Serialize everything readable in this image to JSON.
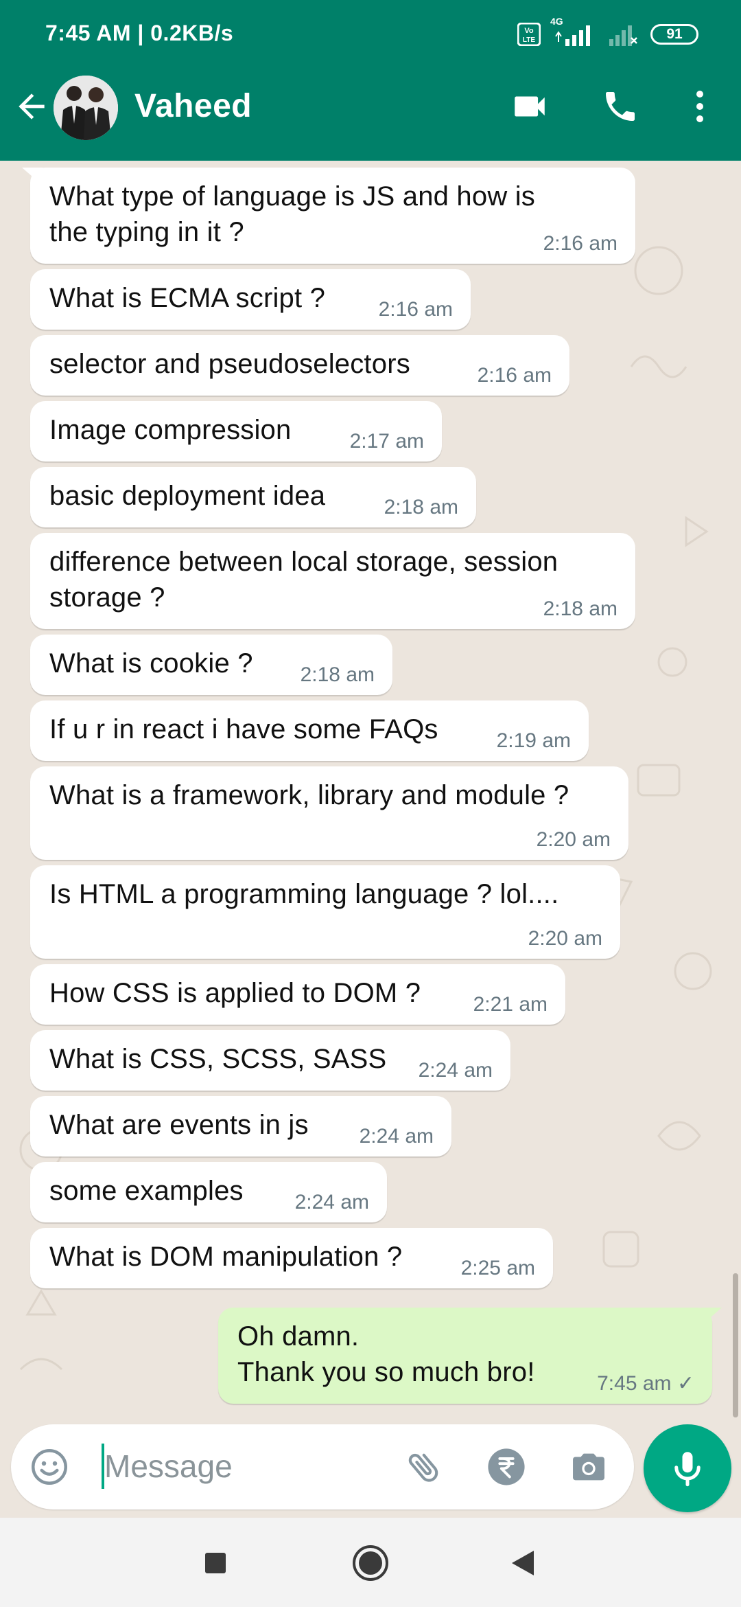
{
  "status_bar": {
    "time": "7:45 AM | 0.2KB/s",
    "network": "4G",
    "volte": "Vo LTE",
    "battery": "91"
  },
  "header": {
    "contact_name": "Vaheed",
    "icons": [
      "back-arrow-icon",
      "avatar",
      "video-call-icon",
      "voice-call-icon",
      "more-options-icon"
    ],
    "color": "#008069"
  },
  "messages": [
    {
      "direction": "in",
      "text": "What type of language is JS and how is\nthe typing in it ?",
      "time": "2:16 am"
    },
    {
      "direction": "in",
      "text": "What is ECMA script ?",
      "time": "2:16 am"
    },
    {
      "direction": "in",
      "text": "selector and pseudoselectors",
      "time": "2:16 am"
    },
    {
      "direction": "in",
      "text": "Image compression",
      "time": "2:17 am"
    },
    {
      "direction": "in",
      "text": "basic deployment idea",
      "time": "2:18 am"
    },
    {
      "direction": "in",
      "text": "difference between local storage, session\nstorage ?",
      "time": "2:18 am"
    },
    {
      "direction": "in",
      "text": "What is cookie ?",
      "time": "2:18 am"
    },
    {
      "direction": "in",
      "text": "If u r in react i have some FAQs",
      "time": "2:19 am"
    },
    {
      "direction": "in",
      "text": "What is a framework, library and module ?",
      "time": "2:20 am"
    },
    {
      "direction": "in",
      "text": "Is HTML a programming language ? lol....",
      "time": "2:20 am"
    },
    {
      "direction": "in",
      "text": "How CSS is applied to DOM ?",
      "time": "2:21 am"
    },
    {
      "direction": "in",
      "text": "What is CSS, SCSS, SASS",
      "time": "2:24 am"
    },
    {
      "direction": "in",
      "text": "What are events in js",
      "time": "2:24 am"
    },
    {
      "direction": "in",
      "text": "some examples",
      "time": "2:24 am"
    },
    {
      "direction": "in",
      "text": "What is DOM manipulation ?",
      "time": "2:25 am"
    },
    {
      "direction": "out",
      "text": "Oh damn.\nThank you so much bro!",
      "time": "7:45 am ✓"
    }
  ],
  "input": {
    "placeholder": "Message",
    "icons": [
      "emoji-icon",
      "attach-icon",
      "rupee-payment-icon",
      "camera-icon",
      "mic-icon"
    ]
  },
  "nav": {
    "icons": [
      "recents-square-icon",
      "home-circle-icon",
      "back-triangle-icon"
    ]
  }
}
